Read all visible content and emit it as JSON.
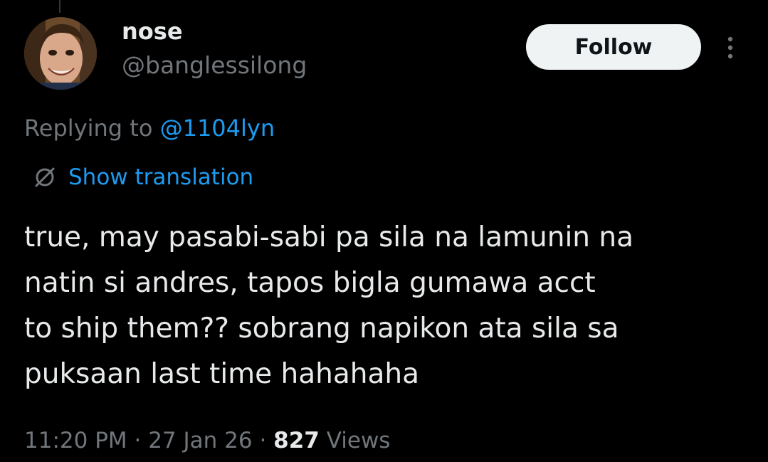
{
  "colors": {
    "background": "#000000",
    "primary_text": "#e7e9ea",
    "secondary_text": "#71767b",
    "accent": "#1d9bf0",
    "follow_bg": "#eff3f4"
  },
  "author": {
    "display_name": "nose",
    "handle": "@banglessilong",
    "avatar_icon": "avatar-photo"
  },
  "actions": {
    "follow_label": "Follow",
    "more_icon": "more-vertical-icon"
  },
  "reply": {
    "prefix": "Replying to ",
    "mention": "@1104lyn"
  },
  "translation": {
    "icon": "globe-icon",
    "label": "Show translation"
  },
  "tweet": {
    "lines": [
      "true, may pasabi-sabi pa sila na lamunin na",
      "natin si andres, tapos bigla gumawa acct",
      "to ship them?? sobrang napikon ata sila sa",
      "puksaan last time hahahaha"
    ]
  },
  "meta": {
    "time": "11:20 PM",
    "separator": " · ",
    "date": "27 Jan 26",
    "views_count": "827",
    "views_label": " Views"
  }
}
